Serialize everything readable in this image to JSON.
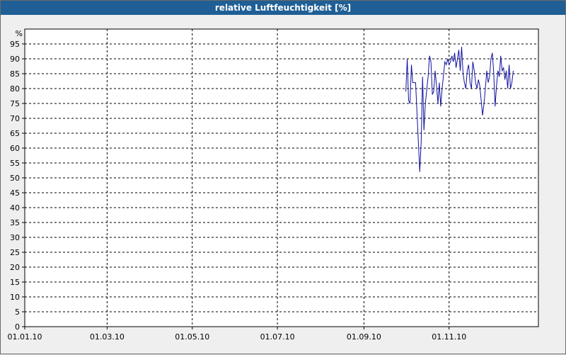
{
  "chart_data": {
    "type": "line",
    "title": "relative Luftfeuchtigkeit [%]",
    "ylabel": "%",
    "xlabel": "",
    "ylim": [
      0,
      95
    ],
    "yticks": [
      0,
      5,
      10,
      15,
      20,
      25,
      30,
      35,
      40,
      45,
      50,
      55,
      60,
      65,
      70,
      75,
      80,
      85,
      90,
      95
    ],
    "xlim": [
      "2010-01-01",
      "2011-01-04"
    ],
    "xticks": [
      {
        "date": "2010-01-01",
        "label": "01.01.10"
      },
      {
        "date": "2010-03-01",
        "label": "01.03.10"
      },
      {
        "date": "2010-05-01",
        "label": "01.05.10"
      },
      {
        "date": "2010-07-01",
        "label": "01.07.10"
      },
      {
        "date": "2010-09-01",
        "label": "01.09.10"
      },
      {
        "date": "2010-11-01",
        "label": "01.11.10"
      }
    ],
    "grid": true,
    "colors": {
      "line": "#1010a0",
      "titlebar": "#1f5f95",
      "plot_bg": "#ffffff",
      "grid": "#000000"
    },
    "series": [
      {
        "name": "",
        "points": [
          [
            "2010-10-01",
            79
          ],
          [
            "2010-10-02",
            90
          ],
          [
            "2010-10-03",
            76
          ],
          [
            "2010-10-04",
            75
          ],
          [
            "2010-10-05",
            88
          ],
          [
            "2010-10-06",
            82
          ],
          [
            "2010-10-07",
            82
          ],
          [
            "2010-10-08",
            82
          ],
          [
            "2010-10-11",
            52
          ],
          [
            "2010-10-12",
            62
          ],
          [
            "2010-10-13",
            84
          ],
          [
            "2010-10-14",
            66
          ],
          [
            "2010-10-15",
            75
          ],
          [
            "2010-10-17",
            84
          ],
          [
            "2010-10-18",
            91
          ],
          [
            "2010-10-19",
            89
          ],
          [
            "2010-10-20",
            78
          ],
          [
            "2010-10-21",
            79
          ],
          [
            "2010-10-22",
            86
          ],
          [
            "2010-10-23",
            81
          ],
          [
            "2010-10-24",
            75
          ],
          [
            "2010-10-25",
            82
          ],
          [
            "2010-10-26",
            74
          ],
          [
            "2010-10-27",
            80
          ],
          [
            "2010-10-29",
            89
          ],
          [
            "2010-10-30",
            88
          ],
          [
            "2010-10-31",
            90
          ],
          [
            "2010-11-01",
            88
          ],
          [
            "2010-11-02",
            89
          ],
          [
            "2010-11-03",
            91
          ],
          [
            "2010-11-04",
            89
          ],
          [
            "2010-11-05",
            92
          ],
          [
            "2010-11-06",
            87
          ],
          [
            "2010-11-07",
            90
          ],
          [
            "2010-11-08",
            93
          ],
          [
            "2010-11-09",
            86
          ],
          [
            "2010-11-10",
            94
          ],
          [
            "2010-11-11",
            85
          ],
          [
            "2010-11-12",
            82
          ],
          [
            "2010-11-13",
            80
          ],
          [
            "2010-11-14",
            86
          ],
          [
            "2010-11-15",
            88
          ],
          [
            "2010-11-16",
            82
          ],
          [
            "2010-11-17",
            80
          ],
          [
            "2010-11-18",
            89
          ],
          [
            "2010-11-19",
            86
          ],
          [
            "2010-11-20",
            82
          ],
          [
            "2010-11-21",
            80
          ],
          [
            "2010-11-22",
            83
          ],
          [
            "2010-11-23",
            81
          ],
          [
            "2010-11-24",
            76
          ],
          [
            "2010-11-25",
            71
          ],
          [
            "2010-11-26",
            75
          ],
          [
            "2010-11-27",
            80
          ],
          [
            "2010-11-28",
            86
          ],
          [
            "2010-11-29",
            82
          ],
          [
            "2010-11-30",
            84
          ],
          [
            "2010-12-01",
            90
          ],
          [
            "2010-12-02",
            92
          ],
          [
            "2010-12-03",
            85
          ],
          [
            "2010-12-04",
            74
          ],
          [
            "2010-12-05",
            81
          ],
          [
            "2010-12-06",
            86
          ],
          [
            "2010-12-07",
            84
          ],
          [
            "2010-12-08",
            91
          ],
          [
            "2010-12-09",
            86
          ],
          [
            "2010-12-10",
            87
          ],
          [
            "2010-12-11",
            83
          ],
          [
            "2010-12-12",
            86
          ],
          [
            "2010-12-13",
            80
          ],
          [
            "2010-12-14",
            88
          ],
          [
            "2010-12-15",
            80
          ],
          [
            "2010-12-16",
            82
          ],
          [
            "2010-12-17",
            86
          ]
        ]
      }
    ]
  }
}
